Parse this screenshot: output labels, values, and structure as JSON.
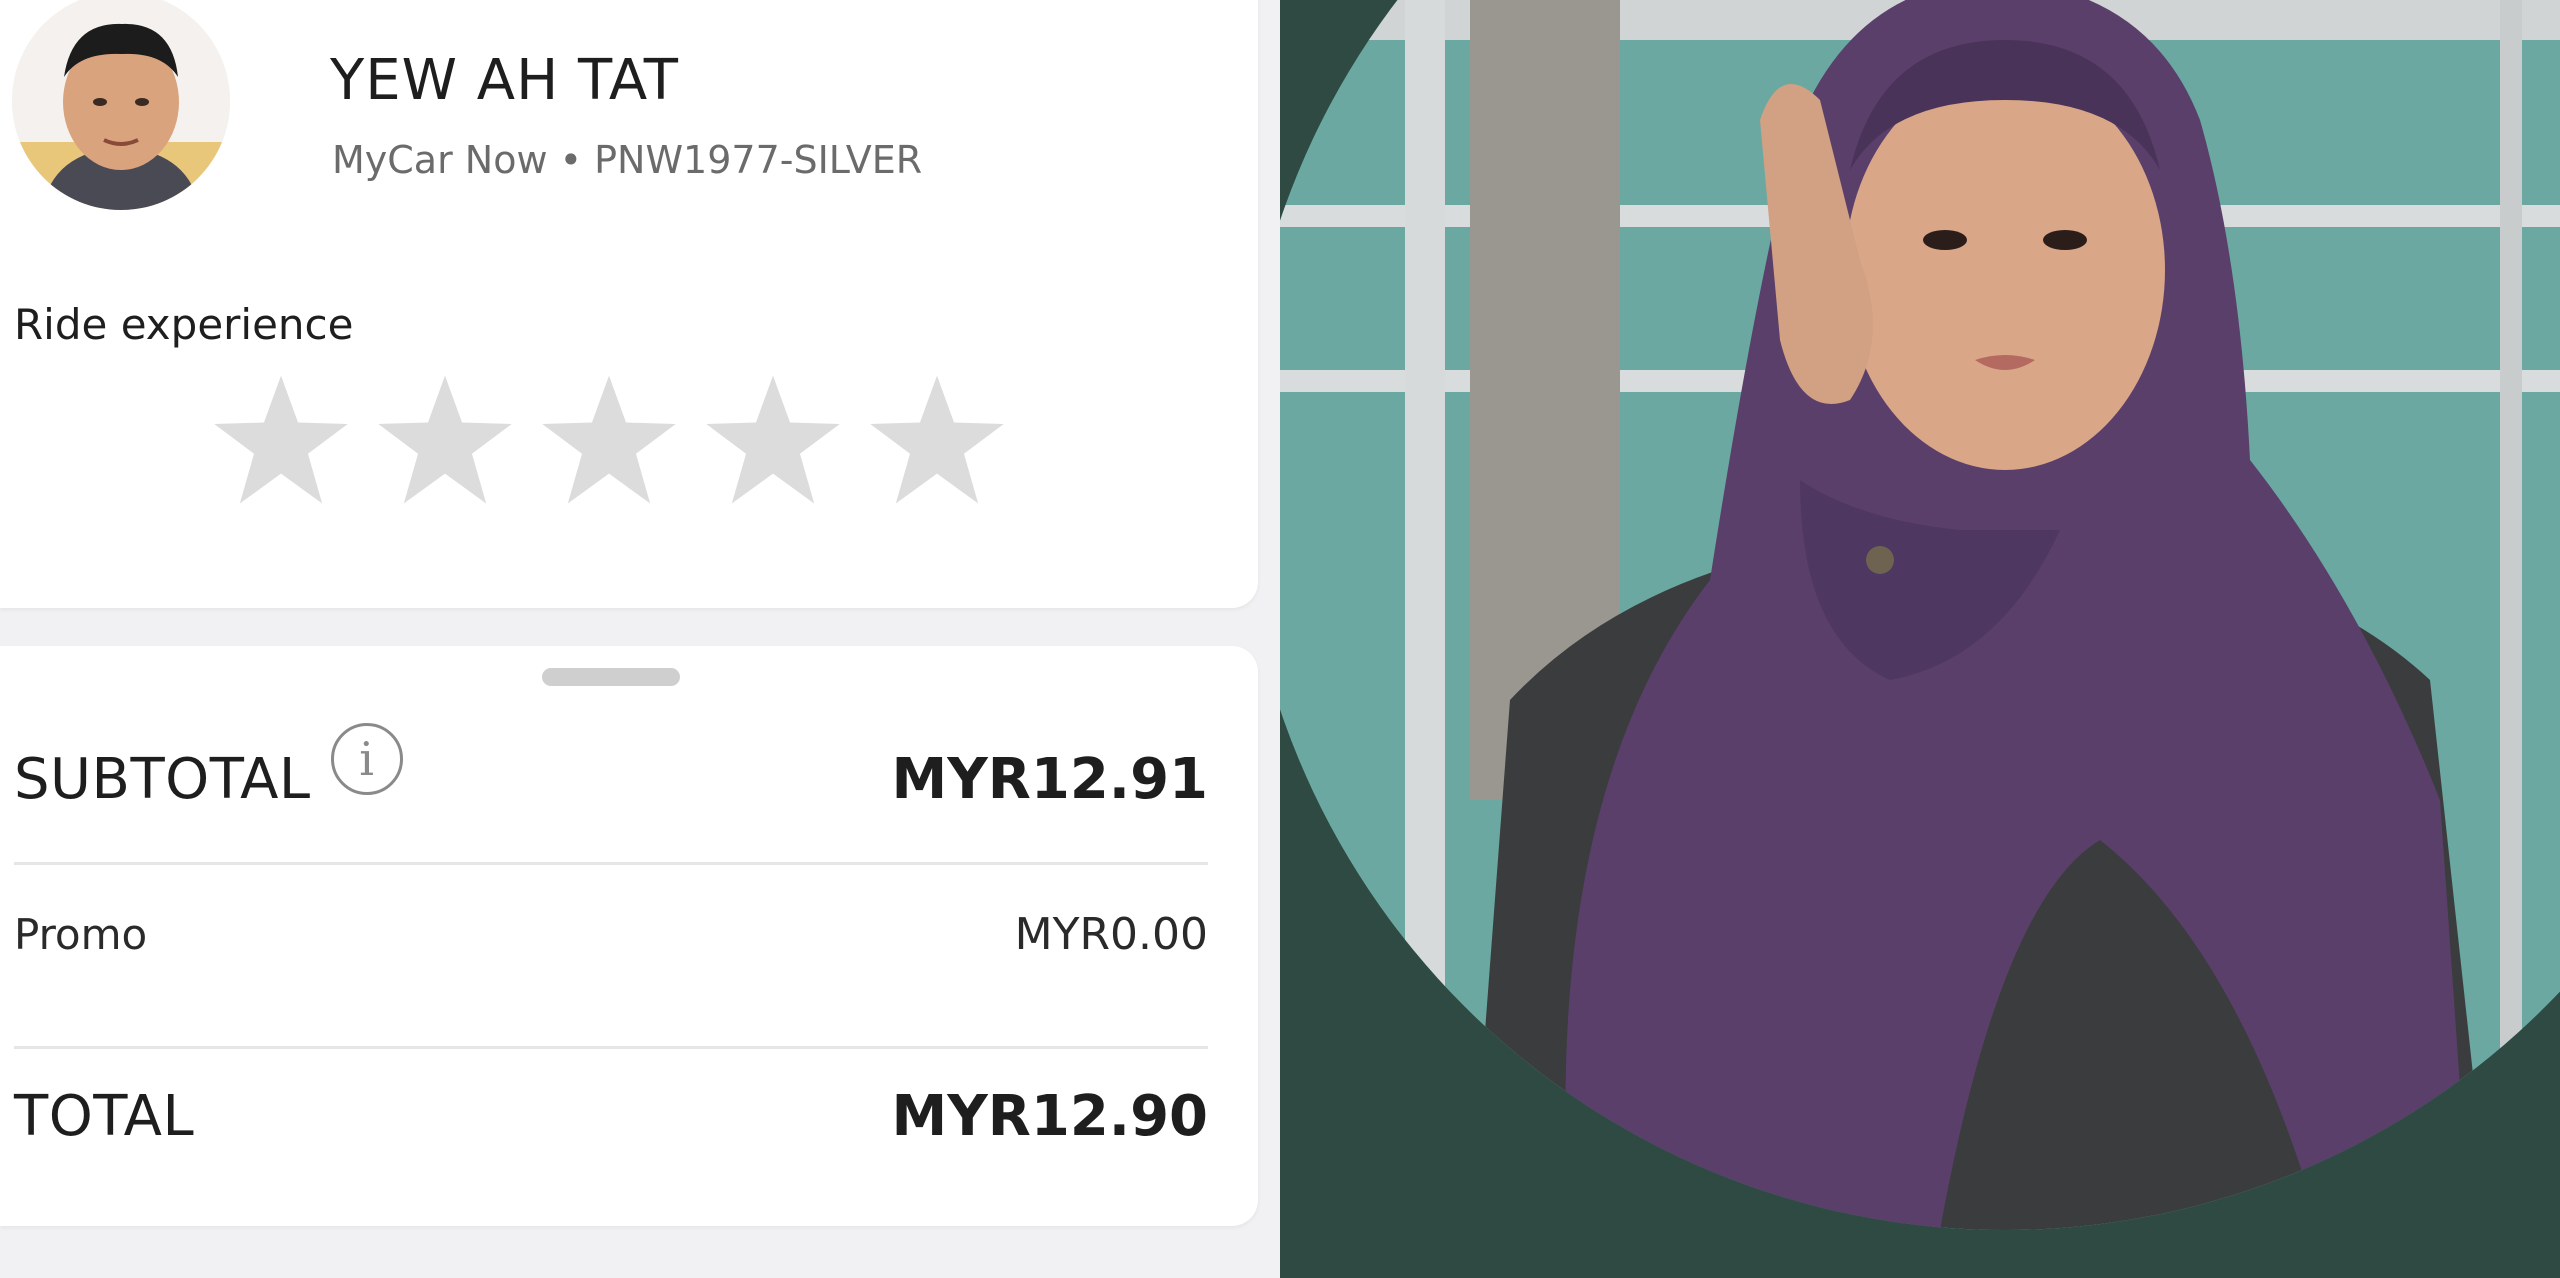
{
  "driver": {
    "name": "YEW AH TAT",
    "subtitle": "MyCar Now • PNW1977-SILVER",
    "avatar_icon": "driver-avatar-photo"
  },
  "rating": {
    "label": "Ride experience",
    "stars_total": 5,
    "stars_selected": 0,
    "star_icon": "star-icon",
    "star_color": "#dcdcdc"
  },
  "summary": {
    "subtotal_label": "SUBTOTAL",
    "subtotal_value": "MYR12.91",
    "info_icon": "info-icon",
    "info_glyph": "i",
    "promo_label": "Promo",
    "promo_value": "MYR0.00",
    "total_label": "TOTAL",
    "total_value": "MYR12.90"
  },
  "colors": {
    "card_bg": "#ffffff",
    "page_bg": "#f1f1f3",
    "text_primary": "#1e1e1e",
    "text_secondary": "#6b6b6b",
    "right_bg": "#2f4a42",
    "hijab": "#5a3f6b"
  }
}
